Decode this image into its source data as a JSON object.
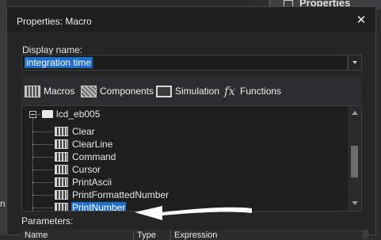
{
  "background": {
    "panel_title": "Properties",
    "left_label": "n"
  },
  "dialog": {
    "title": "Properties: Macro",
    "close_glyph": "✕",
    "display_name_label": "Display name:",
    "display_name_value": "integration time"
  },
  "tabs": [
    {
      "label": "Macros",
      "icon": "macros-icon"
    },
    {
      "label": "Components",
      "icon": "components-icon"
    },
    {
      "label": "Simulation",
      "icon": "simulation-icon"
    },
    {
      "label": "Functions",
      "icon": "fx-icon",
      "glyph": "fx"
    }
  ],
  "tree": {
    "root": "lcd_eb005",
    "items": [
      "Clear",
      "ClearLine",
      "Command",
      "Cursor",
      "PrintAscii",
      "PrintFormattedNumber",
      "PrintNumber"
    ],
    "selected": "PrintNumber"
  },
  "parameters": {
    "label": "Parameters:",
    "columns": [
      "Name",
      "Type",
      "Expression"
    ]
  },
  "colors": {
    "selection": "#1f6fc8",
    "dialog_bg": "#252526",
    "annotation_arrow": "#ffffff"
  }
}
